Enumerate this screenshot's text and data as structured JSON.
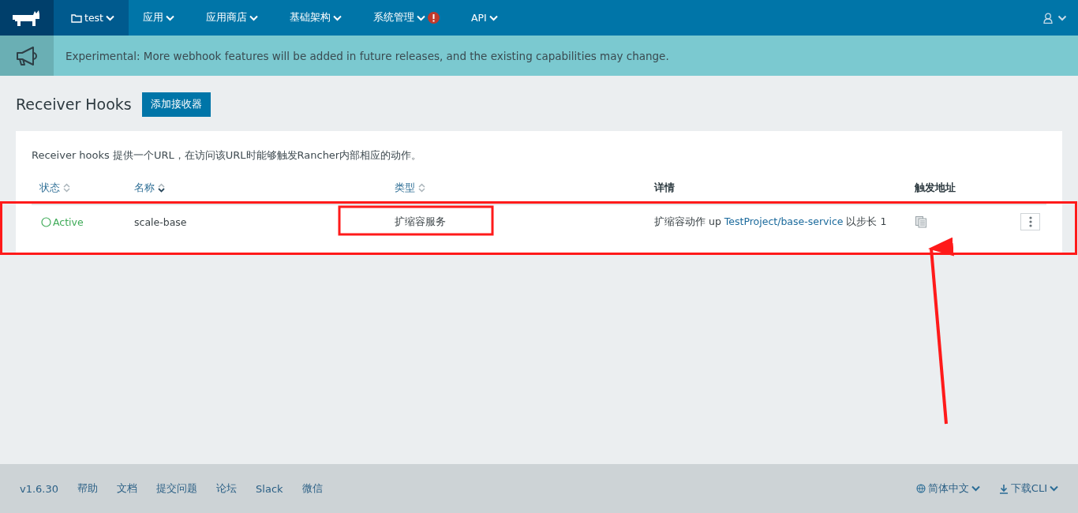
{
  "nav": {
    "items": [
      {
        "label": "test",
        "selected": true,
        "kind": "project",
        "alert": false
      },
      {
        "label": "应用",
        "selected": false,
        "kind": "menu",
        "alert": false
      },
      {
        "label": "应用商店",
        "selected": false,
        "kind": "menu",
        "alert": false
      },
      {
        "label": "基础架构",
        "selected": false,
        "kind": "menu",
        "alert": false
      },
      {
        "label": "系统管理",
        "selected": false,
        "kind": "menu",
        "alert": true
      },
      {
        "label": "API",
        "selected": false,
        "kind": "menu",
        "alert": false
      }
    ]
  },
  "banner": {
    "text": "Experimental: More webhook features will be added in future releases, and the existing capabilities may change."
  },
  "page": {
    "title": "Receiver Hooks",
    "add_button": "添加接收器"
  },
  "card": {
    "description": "Receiver hooks 提供一个URL，在访问该URL时能够触发Rancher内部相应的动作。",
    "columns": [
      {
        "label": "状态",
        "sortable": true,
        "sorted": false
      },
      {
        "label": "名称",
        "sortable": true,
        "sorted": true
      },
      {
        "label": "类型",
        "sortable": true,
        "sorted": false
      },
      {
        "label": "详情",
        "sortable": false
      },
      {
        "label": "触发地址",
        "sortable": false
      }
    ],
    "rows": [
      {
        "state": "Active",
        "name": "scale-base",
        "type": "扩缩容服务",
        "detail_prefix": "扩缩容动作 up ",
        "detail_link": "TestProject/base-service",
        "detail_suffix": " 以步长 1"
      }
    ]
  },
  "footer": {
    "links": [
      "v1.6.30",
      "帮助",
      "文档",
      "提交问题",
      "论坛",
      "Slack",
      "微信"
    ],
    "language": "简体中文",
    "download": "下载CLI"
  }
}
